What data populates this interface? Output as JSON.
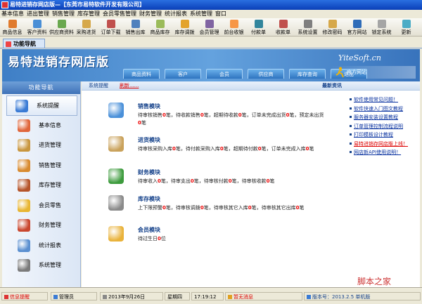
{
  "window": {
    "title": "易特进销存网店版—【东莞市易特软件开发有限公司】"
  },
  "menu": [
    "基本信息",
    "进出管理",
    "销售管理",
    "库存管理",
    "会员零售管理",
    "财务管理",
    "统计报表",
    "系统管理",
    "窗口"
  ],
  "toolbar": [
    {
      "label": "商品信息",
      "color": "#e07a2c"
    },
    {
      "label": "客户资料",
      "color": "#4a8fd6"
    },
    {
      "label": "供应商资料",
      "color": "#6aa84f"
    },
    {
      "label": "采购进货",
      "color": "#d6a84a"
    },
    {
      "label": "订单下载",
      "color": "#c0504d"
    },
    {
      "label": "销售出库",
      "color": "#4f81bd"
    },
    {
      "label": "商品库存",
      "color": "#9bbb59"
    },
    {
      "label": "库存调拨",
      "color": "#e3a32b"
    },
    {
      "label": "会员管理",
      "color": "#8064a2"
    },
    {
      "label": "前台收银",
      "color": "#f79646"
    },
    {
      "label": "付款单",
      "color": "#31859c"
    },
    {
      "label": "收款单",
      "color": "#c0504d"
    },
    {
      "label": "系统设置",
      "color": "#7f7f7f"
    },
    {
      "label": "修改密码",
      "color": "#d6a84a"
    },
    {
      "label": "官方网站",
      "color": "#2f6cb8"
    },
    {
      "label": "锁定系统",
      "color": "#a5a5a5"
    },
    {
      "label": "更新",
      "color": "#4bacc6"
    }
  ],
  "doc_tab": "功能导航",
  "banner": {
    "logo": "易特进销存网店版",
    "site": "YiteSoft.cn",
    "tabs": [
      "商品资料",
      "客户",
      "会员",
      "供应商",
      "库存查询",
      "退出"
    ],
    "official": "官方网站"
  },
  "sidebar": {
    "title": "功能导航",
    "items": [
      {
        "label": "系统提醒",
        "color": "#3a7bd5"
      },
      {
        "label": "基本信息",
        "color": "#e0653a"
      },
      {
        "label": "进货管理",
        "color": "#c8963e"
      },
      {
        "label": "销售管理",
        "color": "#d88a2e"
      },
      {
        "label": "库存管理",
        "color": "#b5542a"
      },
      {
        "label": "会员零售",
        "color": "#e8b530"
      },
      {
        "label": "财务管理",
        "color": "#c9462e"
      },
      {
        "label": "统计报表",
        "color": "#5a8fd0"
      },
      {
        "label": "系统管理",
        "color": "#7a7a7a"
      }
    ]
  },
  "main": {
    "header_left": "系统提醒",
    "refresh": "刷新......",
    "header_right": "最新资讯",
    "modules": [
      {
        "title": "销售模块",
        "color": "#4a90d9",
        "desc": [
          [
            "待审核销售",
            "0",
            "笔，待收款销售",
            "0",
            "笔，超期待收款",
            "0",
            "笔，订单未完成出货",
            "0",
            "笔，预定未出货",
            "0",
            "笔"
          ]
        ]
      },
      {
        "title": "进货模块",
        "color": "#c9a15a",
        "desc": [
          [
            "待审核采购入库",
            "0",
            "笔，待付款采购入库",
            "0",
            "笔，超期待付款",
            "0",
            "笔，订单未完成入库",
            "0",
            "笔"
          ]
        ]
      },
      {
        "title": "财务模块",
        "color": "#3d9b3d",
        "desc": [
          [
            "待审收入",
            "0",
            "笔，待审支出",
            "0",
            "笔，待审核付款",
            "0",
            "笔，待审核收款",
            "0",
            "笔"
          ]
        ]
      },
      {
        "title": "库存模块",
        "color": "#8a8a8a",
        "desc": [
          [
            "上下限预警",
            "0",
            "笔，待审核调拨",
            "0",
            "笔，待审核其它入库",
            "0",
            "笔，待审核其它出库",
            "0",
            "笔"
          ]
        ]
      },
      {
        "title": "会员模块",
        "color": "#e9b23a",
        "desc": [
          [
            "待过生日",
            "0",
            "位"
          ]
        ]
      }
    ],
    "news": [
      {
        "text": "软件使用常见问题！",
        "hot": false
      },
      {
        "text": "软件快速入门图文教程",
        "hot": false
      },
      {
        "text": "服务器安装设置教程",
        "hot": false
      },
      {
        "text": "订单管理控制流程说明",
        "hot": false
      },
      {
        "text": "打印模板设计教程",
        "hot": false
      },
      {
        "text": "易特进销存网店版上线！",
        "hot": true
      },
      {
        "text": "网店新API使用说明！",
        "hot": false
      }
    ]
  },
  "status": {
    "notice": "信息提醒",
    "user": "管理员",
    "date": "2013年9月26日",
    "weekday": "星期四",
    "time": "17:19:12",
    "msg": "暂无消息",
    "version": "版本号：2013.2.5 单机版"
  },
  "watermark": "脚本之家"
}
